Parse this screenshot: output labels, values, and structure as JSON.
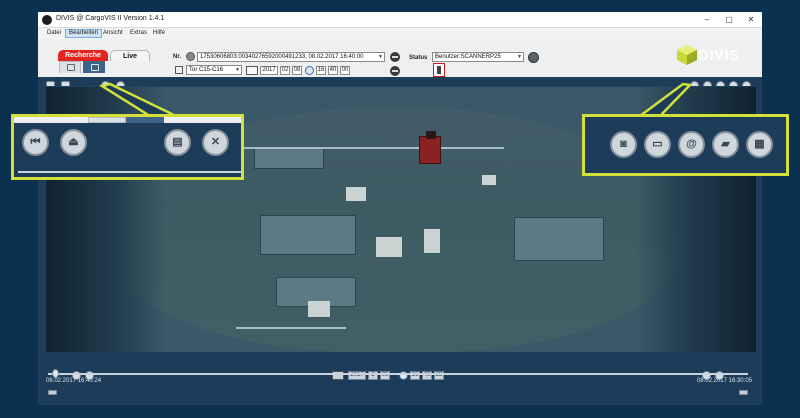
{
  "window": {
    "title": "DIVIS @ CargoVIS II Version 1.4.1",
    "controls": {
      "minimize": "–",
      "maximize": "▢",
      "close": "✕"
    }
  },
  "menu": {
    "items": [
      {
        "label": "Datei"
      },
      {
        "label": "Bearbeiten",
        "active": true
      },
      {
        "label": "Ansicht"
      },
      {
        "label": "Extras"
      },
      {
        "label": "Hilfe"
      }
    ]
  },
  "toolbar": {
    "tabs": {
      "recherche": "Recherche",
      "live": "Live"
    },
    "nr_label": "Nr.",
    "nr_value": "17530606803:00340276592000491233, 08.02.2017 16:40:00",
    "status_label": "Status",
    "status_value": "Benutzer:SCANNERP25",
    "gate_value": "Tor C15-C16",
    "date": {
      "year": "2017",
      "month": "02",
      "day": "08"
    },
    "time": {
      "hour": "16",
      "minute": "40",
      "second": "00"
    }
  },
  "logo": {
    "text": "DIVIS",
    "accent_color": "#c8d83a"
  },
  "callouts": {
    "left_icons": [
      "skip-back-icon",
      "eject-icon",
      "save-icon",
      "close-icon"
    ],
    "right_icons": [
      "camera-icon",
      "printer-icon",
      "email-icon",
      "comment-icon",
      "clapperboard-icon"
    ]
  },
  "timeline": {
    "date": {
      "year": "2017",
      "month": "2",
      "day": "08"
    },
    "time": {
      "hour": "16",
      "minute": "40",
      "second": "22"
    },
    "start_timestamp": "08.02.2017 16:40:24",
    "end_timestamp": "08.02.2017 16:30:05",
    "progress": 0.01
  },
  "colors": {
    "highlight": "#d4e03a",
    "panel": "#1d3c5a",
    "background": "#0c3050",
    "recherche_tab": "#e32521"
  }
}
